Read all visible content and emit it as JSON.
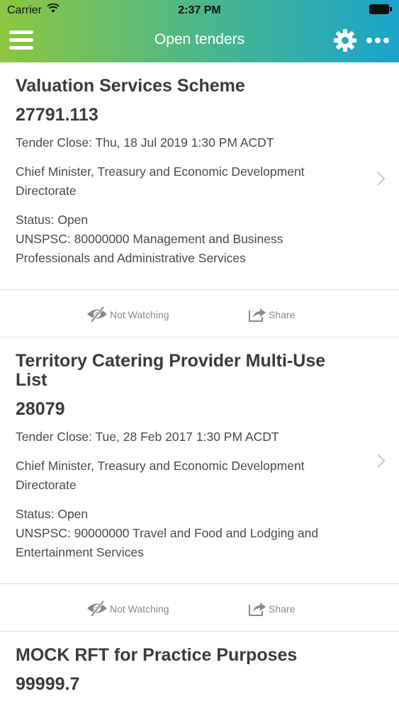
{
  "status_bar": {
    "carrier": "Carrier",
    "time": "2:37 PM"
  },
  "header": {
    "title": "Open tenders",
    "menu_icon": "hamburger-menu-icon",
    "settings_icon": "gear-icon",
    "more_icon": "more-dots-icon",
    "gradient_colors": [
      "#8cc63f",
      "#4db78a",
      "#1aa4cc"
    ]
  },
  "tenders": [
    {
      "title": "Valuation Services Scheme",
      "id": "27791.113",
      "close": "Tender Close: Thu, 18 Jul 2019 1:30 PM ACDT",
      "org": "Chief Minister, Treasury and Economic Development Directorate",
      "status": "Status: Open",
      "unspsc": "UNSPSC: 80000000 Management and Business Professionals and Administrative Services",
      "watch_label": "Not Watching",
      "share_label": "Share"
    },
    {
      "title": "Territory Catering Provider Multi-Use List",
      "id": "28079",
      "close": "Tender Close: Tue, 28 Feb 2017 1:30 PM ACDT",
      "org": "Chief Minister, Treasury and Economic Development Directorate",
      "status": "Status: Open",
      "unspsc": "UNSPSC: 90000000 Travel and Food and Lodging and Entertainment Services",
      "watch_label": "Not Watching",
      "share_label": "Share"
    },
    {
      "title": "MOCK RFT for Practice Purposes",
      "id": "99999.7"
    }
  ]
}
